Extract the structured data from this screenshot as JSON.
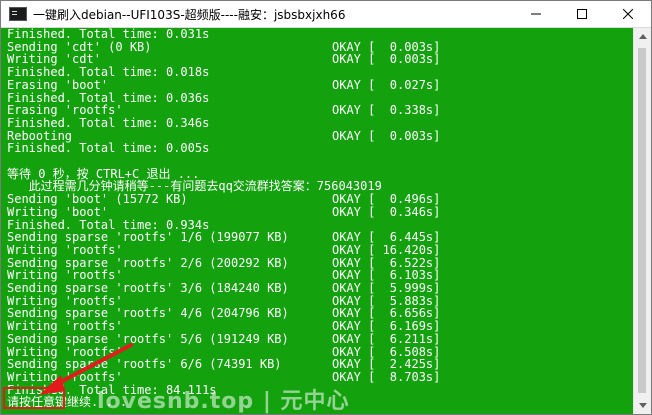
{
  "window": {
    "title": "一键刷入debian--UFI103S-超频版----融安：jsbsbxjxh66",
    "controls": {
      "minimize": "—",
      "maximize": "☐",
      "close": "✕"
    },
    "icon": "console-icon"
  },
  "console": {
    "lines": [
      {
        "text": "Finished. Total time: 0.031s",
        "status": ""
      },
      {
        "text": "Sending 'cdt' (0 KB)",
        "status": "OKAY [  0.003s]"
      },
      {
        "text": "Writing 'cdt'",
        "status": "OKAY [  0.003s]"
      },
      {
        "text": "Finished. Total time: 0.018s",
        "status": ""
      },
      {
        "text": "Erasing 'boot'",
        "status": "OKAY [  0.027s]"
      },
      {
        "text": "Finished. Total time: 0.036s",
        "status": ""
      },
      {
        "text": "Erasing 'rootfs'",
        "status": "OKAY [  0.338s]"
      },
      {
        "text": "Finished. Total time: 0.346s",
        "status": ""
      },
      {
        "text": "Rebooting",
        "status": "OKAY [  0.003s]"
      },
      {
        "text": "Finished. Total time: 0.005s",
        "status": ""
      },
      {
        "text": "",
        "status": ""
      },
      {
        "text": "等待 0 秒，按 CTRL+C 退出 ...",
        "status": ""
      },
      {
        "text": "   此过程需几分钟请稍等---有问题去qq交流群找答案：756043019",
        "status": ""
      },
      {
        "text": "Sending 'boot' (15772 KB)",
        "status": "OKAY [  0.496s]"
      },
      {
        "text": "Writing 'boot'",
        "status": "OKAY [  0.346s]"
      },
      {
        "text": "Finished. Total time: 0.934s",
        "status": ""
      },
      {
        "text": "Sending sparse 'rootfs' 1/6 (199077 KB)",
        "status": "OKAY [  6.445s]"
      },
      {
        "text": "Writing 'rootfs'",
        "status": "OKAY [ 16.420s]"
      },
      {
        "text": "Sending sparse 'rootfs' 2/6 (200292 KB)",
        "status": "OKAY [  6.522s]"
      },
      {
        "text": "Writing 'rootfs'",
        "status": "OKAY [  6.103s]"
      },
      {
        "text": "Sending sparse 'rootfs' 3/6 (184240 KB)",
        "status": "OKAY [  5.999s]"
      },
      {
        "text": "Writing 'rootfs'",
        "status": "OKAY [  5.883s]"
      },
      {
        "text": "Sending sparse 'rootfs' 4/6 (204796 KB)",
        "status": "OKAY [  6.656s]"
      },
      {
        "text": "Writing 'rootfs'",
        "status": "OKAY [  6.169s]"
      },
      {
        "text": "Sending sparse 'rootfs' 5/6 (191249 KB)",
        "status": "OKAY [  6.211s]"
      },
      {
        "text": "Writing 'rootfs'",
        "status": "OKAY [  6.508s]"
      },
      {
        "text": "Sending sparse 'rootfs' 6/6 (74391 KB)",
        "status": "OKAY [  2.425s]"
      },
      {
        "text": "Writing 'rootfs'",
        "status": "OKAY [  8.703s]"
      },
      {
        "text": "Finished. Total time: 84.111s",
        "status": ""
      },
      {
        "text": "请按任意键继续. . .",
        "status": ""
      }
    ]
  },
  "watermark": {
    "text": "lovesnb.top | 元中心"
  },
  "colors": {
    "console_bg": "#13a10e",
    "console_fg": "#ffffff",
    "annotation": "#e21b1b"
  }
}
